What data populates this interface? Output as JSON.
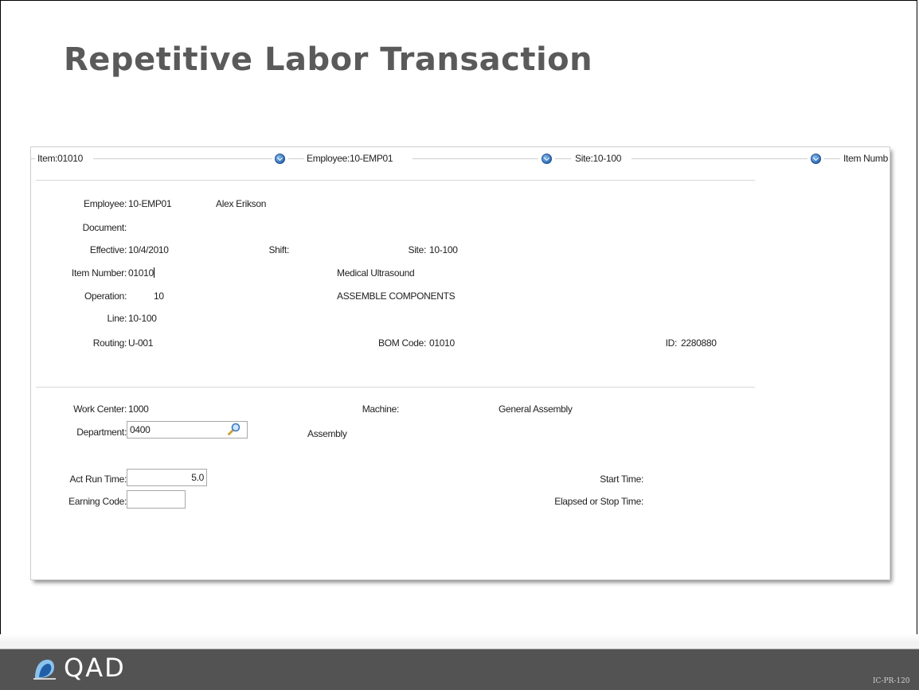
{
  "slide": {
    "title": "Repetitive Labor Transaction",
    "code": "IC-PR-120",
    "logo_text": "QAD"
  },
  "frames": {
    "item": "Item:01010",
    "employee": "Employee:10-EMP01",
    "site": "Site:10-100",
    "item_number": "Item Numb"
  },
  "header": {
    "employee_label": "Employee:",
    "employee_value": "10-EMP01",
    "employee_name": "Alex Erikson",
    "document_label": "Document:",
    "effective_label": "Effective:",
    "effective_value": "10/4/2010",
    "shift_label": "Shift:",
    "site_label": "Site:",
    "site_value": "10-100",
    "item_number_label": "Item Number:",
    "item_number_value": "01010",
    "item_description": "Medical Ultrasound",
    "operation_label": "Operation:",
    "operation_value": "10",
    "operation_description": "ASSEMBLE COMPONENTS",
    "line_label": "Line:",
    "line_value": "10-100",
    "routing_label": "Routing:",
    "routing_value": "U-001",
    "bom_label": "BOM Code:",
    "bom_value": "01010",
    "id_label": "ID:",
    "id_value": "2280880"
  },
  "detail": {
    "work_center_label": "Work Center:",
    "work_center_value": "1000",
    "machine_label": "Machine:",
    "work_center_description": "General Assembly",
    "department_label": "Department:",
    "department_value": "0400",
    "department_description": "Assembly",
    "act_run_time_label": "Act Run Time:",
    "act_run_time_value": "5.0",
    "earning_code_label": "Earning Code:",
    "earning_code_value": "",
    "start_time_label": "Start Time:",
    "elapsed_label": "Elapsed or Stop Time:"
  },
  "icons": {
    "dropdown": "chevron-down-circle-icon",
    "lookup": "magnifier-icon",
    "logo": "qad-logo-icon"
  }
}
